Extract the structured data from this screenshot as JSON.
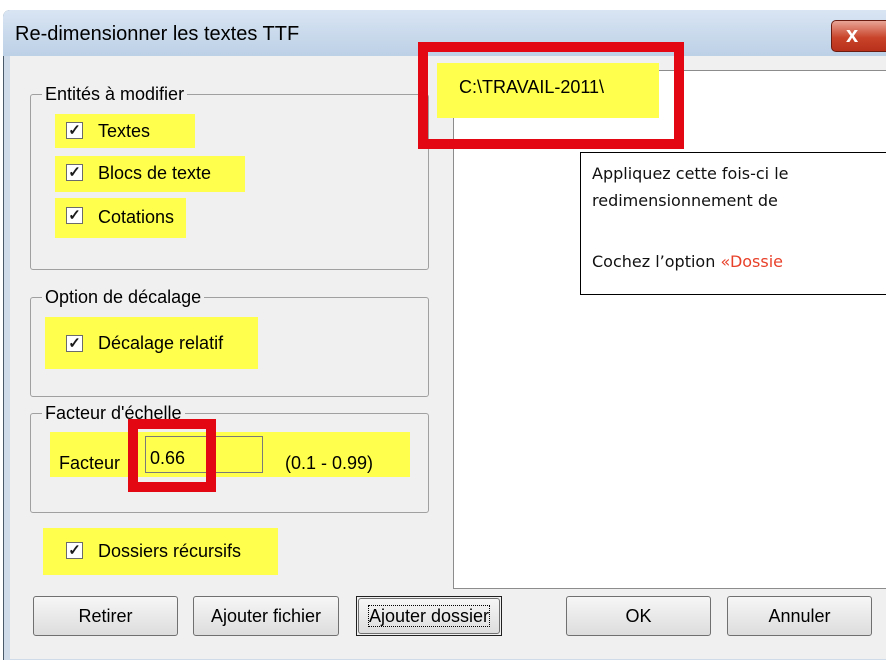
{
  "dialog": {
    "title": "Re-dimensionner  les textes TTF",
    "close_glyph": "x"
  },
  "entities_group": {
    "legend": "Entités à modifier",
    "options": [
      {
        "label": "Textes",
        "checked": true
      },
      {
        "label": "Blocs de texte",
        "checked": true
      },
      {
        "label": "Cotations",
        "checked": true
      }
    ]
  },
  "offset_group": {
    "legend": "Option de décalage",
    "option": {
      "label": "Décalage relatif",
      "checked": true
    }
  },
  "scale_group": {
    "legend": "Facteur d'échelle",
    "factor_label": "Facteur",
    "factor_value": "0.66",
    "range_hint": "(0.1 - 0.99)"
  },
  "recursive_option": {
    "label": "Dossiers récursifs",
    "checked": true
  },
  "check_glyph": "✓",
  "folder_list": {
    "items": [
      "C:\\TRAVAIL-2011\\"
    ]
  },
  "callout": {
    "line1": "Appliquez cette fois-ci le",
    "line2": "redimensionnement de",
    "line3_prefix": "Cochez l’option ",
    "line3_highlight": "«Dossie",
    "highlight_color": "#e8412a"
  },
  "buttons": {
    "remove": "Retirer",
    "add_file": "Ajouter fichier",
    "add_folder": "Ajouter dossier",
    "ok": "OK",
    "cancel": "Annuler"
  },
  "colors": {
    "highlight": "#ffff4d",
    "annotation_red": "#e30613"
  }
}
